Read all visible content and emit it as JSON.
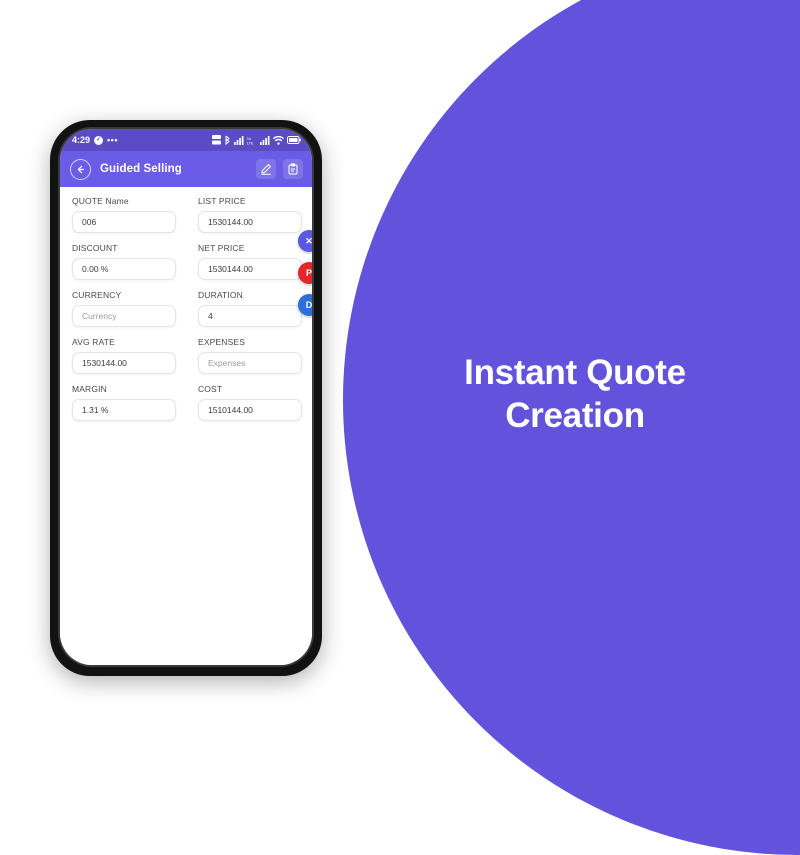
{
  "promo": {
    "headline_line1": "Instant Quote",
    "headline_line2": "Creation",
    "background_color": "#6252DC",
    "text_color": "#FFFFFF"
  },
  "phone": {
    "status_bar": {
      "time": "4:29",
      "check_glyph": "✓",
      "overflow_dots": "•••",
      "icons": [
        "signal-data-icon",
        "bluetooth-icon",
        "signal-bars-icon",
        "volte-icon",
        "signal-bars-2-icon",
        "wifi-icon",
        "battery-icon"
      ],
      "background_color": "#5B4BC4"
    },
    "app_bar": {
      "title": "Guided Selling",
      "back_icon": "arrow-left-icon",
      "actions": [
        {
          "name": "edit-icon",
          "label": "Edit"
        },
        {
          "name": "clipboard-icon",
          "label": "Notes"
        }
      ],
      "background_color": "#6B5CE7"
    },
    "form": {
      "rows": [
        [
          {
            "label": "QUOTE Name",
            "value": "006",
            "is_placeholder": false,
            "field": "quote-name"
          },
          {
            "label": "LIST PRICE",
            "value": "1530144.00",
            "is_placeholder": false,
            "field": "list-price"
          }
        ],
        [
          {
            "label": "DISCOUNT",
            "value": "0.00 %",
            "is_placeholder": false,
            "field": "discount"
          },
          {
            "label": "NET PRICE",
            "value": "1530144.00",
            "is_placeholder": false,
            "field": "net-price"
          }
        ],
        [
          {
            "label": "CURRENCY",
            "value": "Currency",
            "is_placeholder": true,
            "field": "currency"
          },
          {
            "label": "DURATION",
            "value": "4",
            "is_placeholder": false,
            "field": "duration"
          }
        ],
        [
          {
            "label": "AVG RATE",
            "value": "1530144.00",
            "is_placeholder": false,
            "field": "avg-rate"
          },
          {
            "label": "EXPENSES",
            "value": "Expenses",
            "is_placeholder": true,
            "field": "expenses"
          }
        ],
        [
          {
            "label": "MARGIN",
            "value": "1.31 %",
            "is_placeholder": false,
            "field": "margin"
          },
          {
            "label": "COST",
            "value": "1510144.00",
            "is_placeholder": false,
            "field": "cost"
          }
        ]
      ]
    },
    "fabs": [
      {
        "name": "close-fab",
        "letter": "✕",
        "color": "#5A58E0"
      },
      {
        "name": "p-fab",
        "letter": "P",
        "color": "#E4262B"
      },
      {
        "name": "d-fab",
        "letter": "D",
        "color": "#2D6FD8"
      }
    ]
  }
}
